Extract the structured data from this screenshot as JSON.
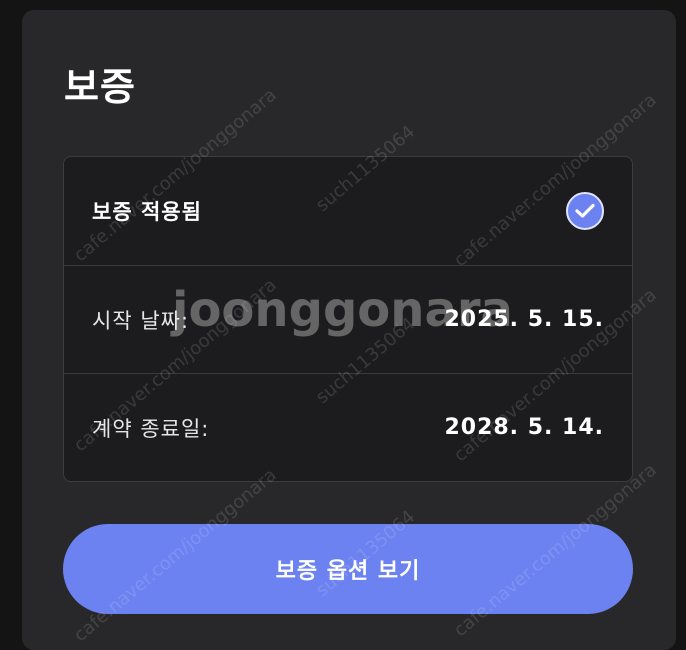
{
  "title": "보증",
  "card": {
    "status_label": "보증 적용됨",
    "status_icon": "check-circle-icon",
    "rows": [
      {
        "label": "시작 날짜:",
        "value": "2025. 5. 15."
      },
      {
        "label": "계약 종료일:",
        "value": "2028. 5. 14."
      }
    ]
  },
  "button": {
    "label": "보증 옵션 보기"
  },
  "watermark": {
    "main": "joonggonara",
    "marks": [
      "cafe.naver.com/joonggonara",
      "such1135064"
    ]
  },
  "colors": {
    "accent": "#6b82f0",
    "panel": "#28282a",
    "card": "#1c1c1e",
    "background": "#141414"
  }
}
